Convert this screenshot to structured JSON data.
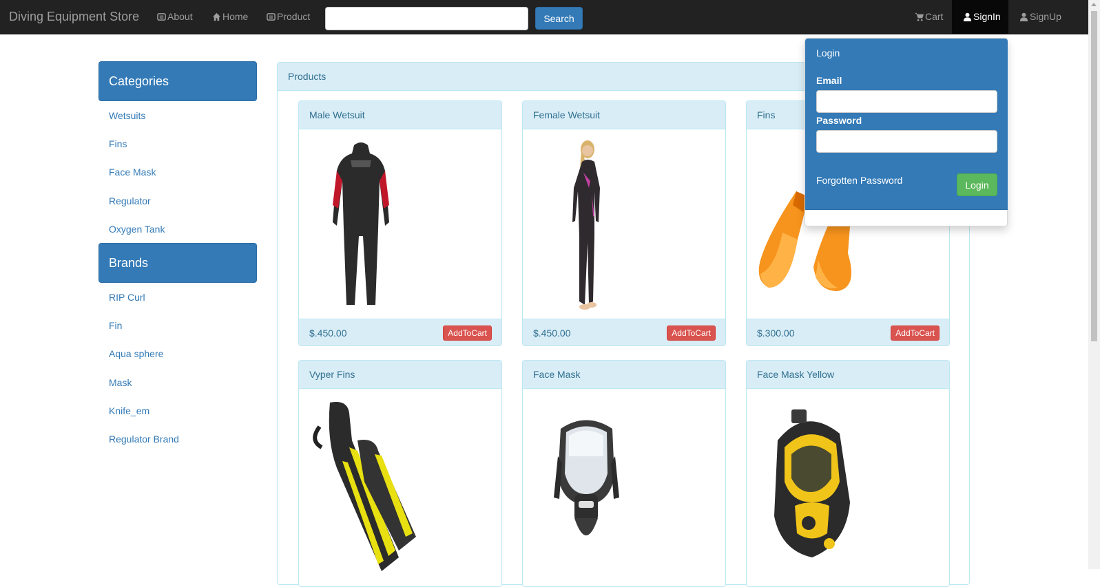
{
  "navbar": {
    "brand": "Diving Equipment Store",
    "about": "About",
    "home": "Home",
    "product": "Product",
    "search_value": "",
    "search_button": "Search",
    "cart": "Cart",
    "signin": "SignIn",
    "signup": "SignUp"
  },
  "sidebar": {
    "categories_heading": "Categories",
    "categories": [
      "Wetsuits",
      "Fins",
      "Face Mask",
      "Regulator",
      "Oxygen Tank"
    ],
    "brands_heading": "Brands",
    "brands": [
      "RIP Curl",
      "Fin",
      "Aqua sphere",
      "Mask",
      "Knife_em",
      "Regulator Brand"
    ]
  },
  "products": {
    "heading": "Products",
    "add_to_cart": "AddToCart",
    "items": [
      {
        "name": "Male Wetsuit",
        "price": "$.450.00"
      },
      {
        "name": "Female Wetsuit",
        "price": "$.450.00"
      },
      {
        "name": "Fins",
        "price": "$.300.00"
      },
      {
        "name": "Vyper Fins",
        "price": ""
      },
      {
        "name": "Face Mask",
        "price": ""
      },
      {
        "name": "Face Mask Yellow",
        "price": ""
      }
    ]
  },
  "login": {
    "title": "Login",
    "email_label": "Email",
    "email_value": "",
    "password_label": "Password",
    "password_value": "",
    "forgot": "Forgotten Password",
    "button": "Login"
  },
  "colors": {
    "navbar": "#222222",
    "primary": "#337ab7",
    "info_panel": "#d9edf7",
    "danger": "#d9534f",
    "success": "#5cb85c"
  }
}
